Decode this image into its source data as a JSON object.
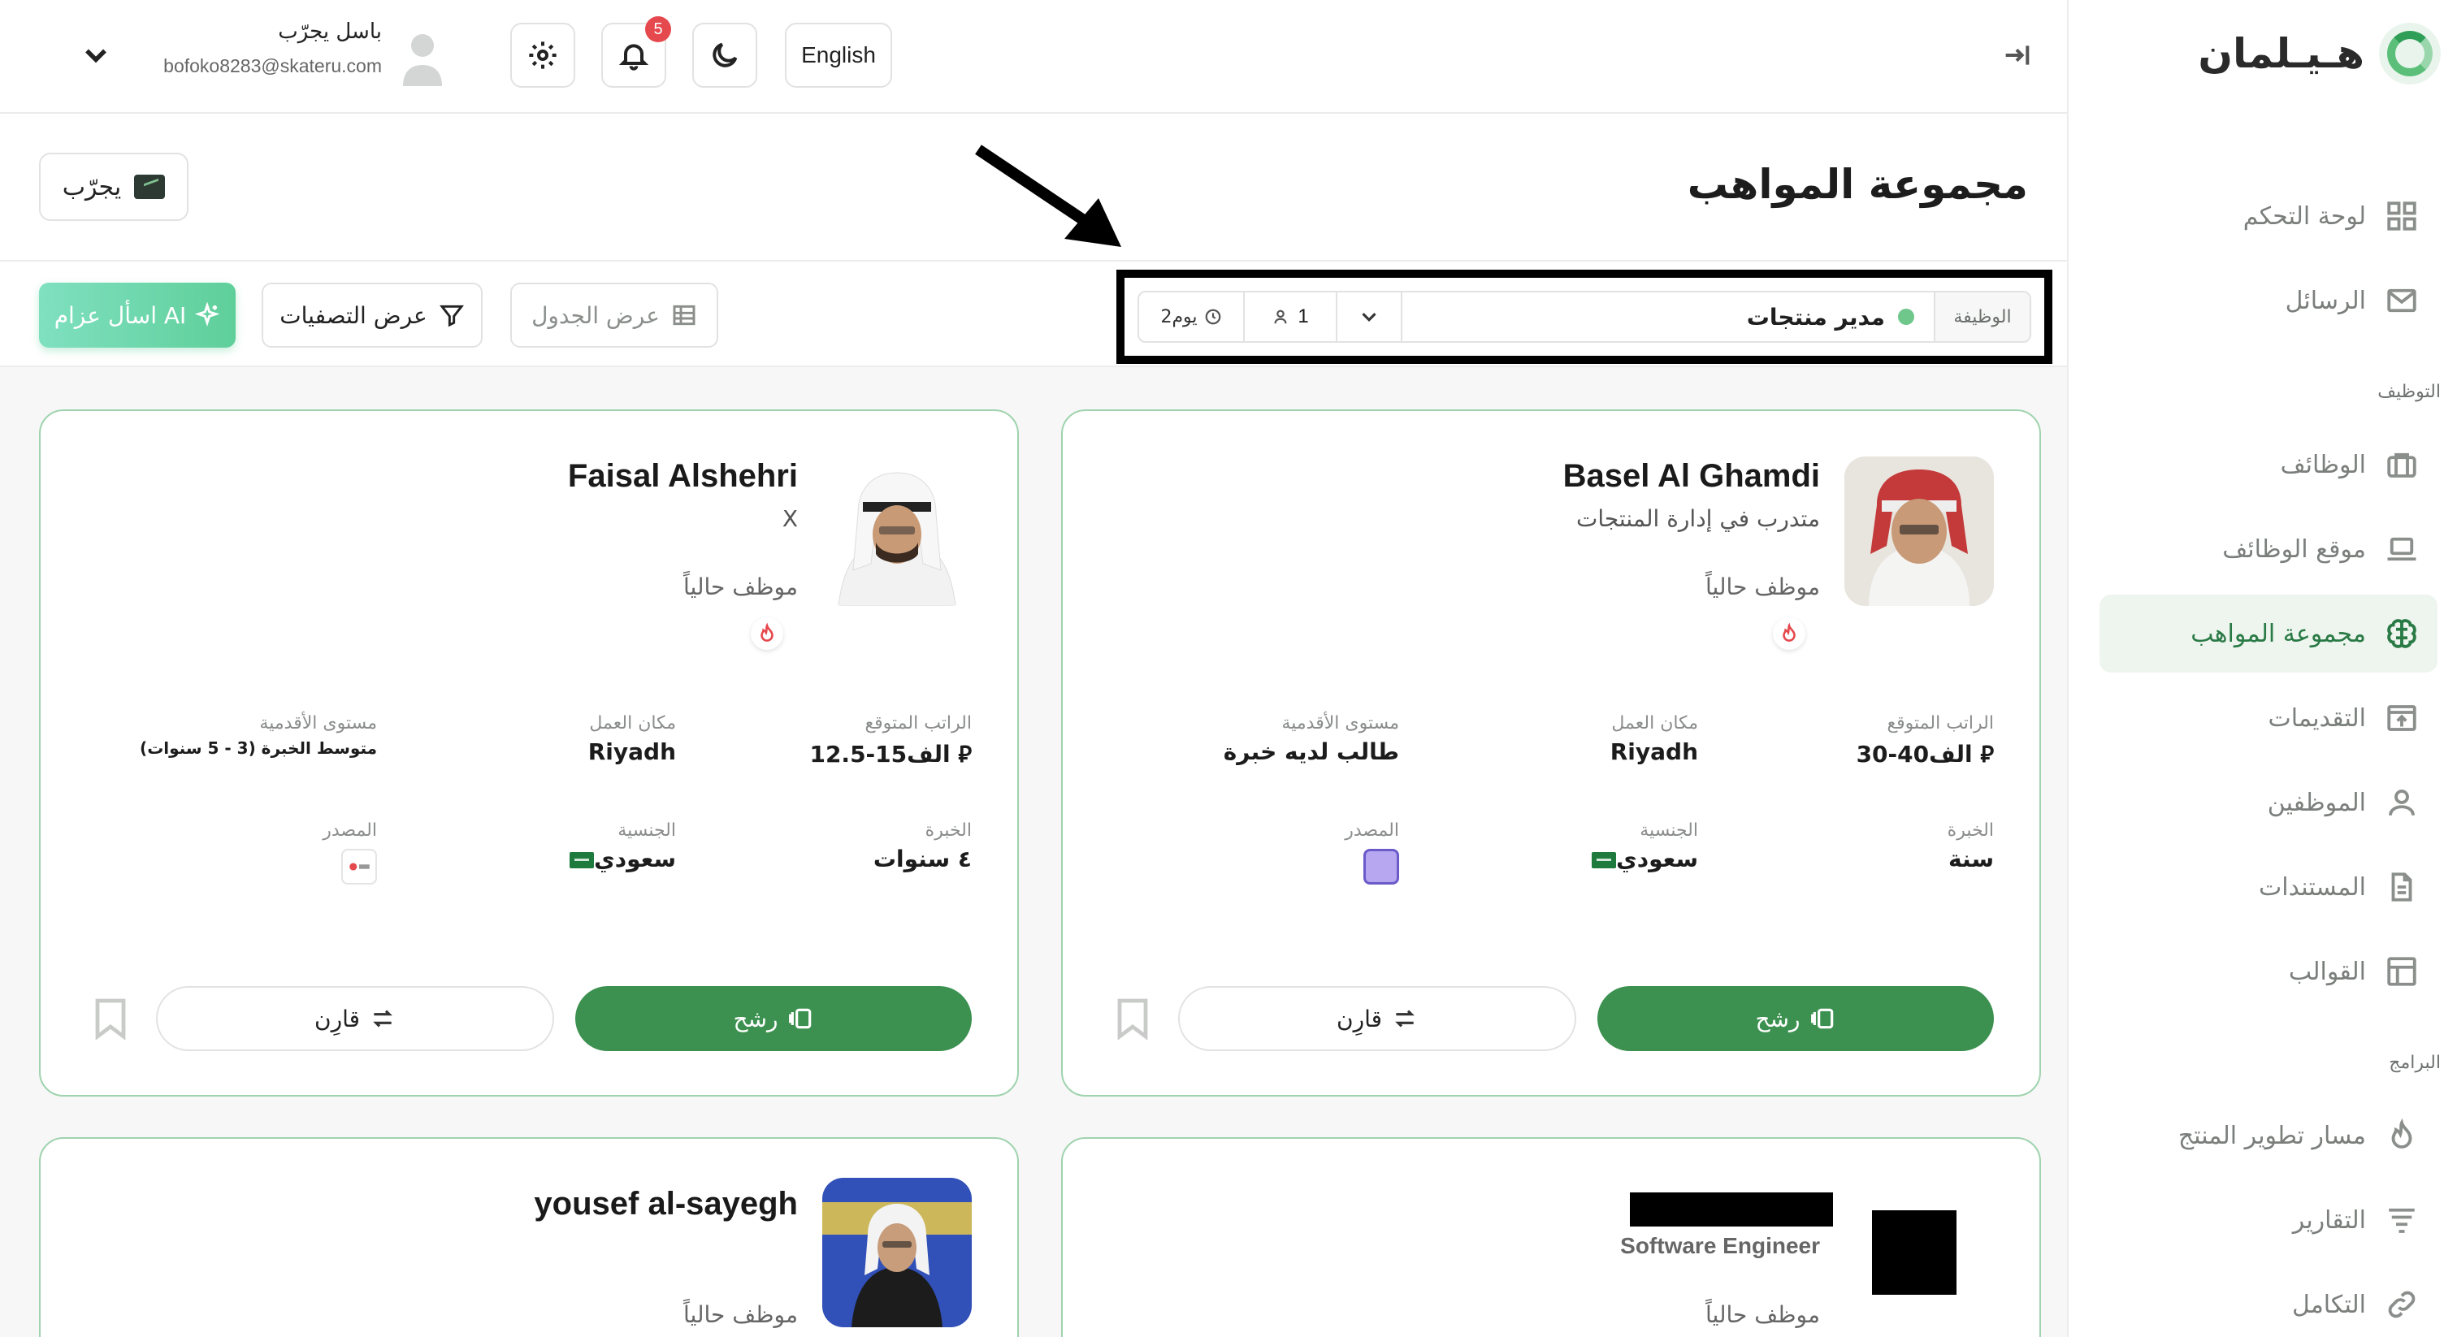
{
  "sidebar": {
    "brand": "هـيـلمان",
    "items": [
      {
        "label": "لوحة التحكم",
        "icon": "dashboard-icon"
      },
      {
        "label": "الرسائل",
        "icon": "mail-icon"
      },
      {
        "label": "الوظائف",
        "icon": "briefcase-icon"
      },
      {
        "label": "موقع الوظائف",
        "icon": "laptop-icon"
      },
      {
        "label": "مجموعة المواهب",
        "icon": "brain-icon"
      },
      {
        "label": "التقديمات",
        "icon": "upload-icon"
      },
      {
        "label": "الموظفين",
        "icon": "user-icon"
      },
      {
        "label": "المستندات",
        "icon": "document-icon"
      },
      {
        "label": "القوالب",
        "icon": "template-icon"
      },
      {
        "label": "مسار تطوير المنتج",
        "icon": "flame-icon"
      },
      {
        "label": "التقارير",
        "icon": "reports-icon"
      },
      {
        "label": "التكامل",
        "icon": "link-icon"
      }
    ],
    "sections": {
      "hiring": "التوظيف",
      "programs": "البرامج"
    },
    "active_item": "مجموعة المواهب"
  },
  "topbar": {
    "user_name": "باسل يجرّب",
    "user_email": "bofoko8283@skateru.com",
    "notifications_count": "5",
    "language_button": "English"
  },
  "header": {
    "title": "مجموعة المواهب",
    "company_button": "يجرّب"
  },
  "toolbar": {
    "job_label": "الوظيفة",
    "job_title": "مدير منتجات",
    "applicants_count": "1",
    "job_age": "2يوم",
    "table_view": "عرض الجدول",
    "filters": "عرض التصفيات",
    "ask_ai": "اسأل عزام AI"
  },
  "labels": {
    "salary": "الراتب المتوقع",
    "location": "مكان العمل",
    "seniority": "مستوى الأقدمية",
    "experience": "الخبرة",
    "nationality": "الجنسية",
    "source": "المصدر",
    "nominate": "رشح",
    "compare": "قارِن"
  },
  "candidates": [
    {
      "name": "Basel Al Ghamdi",
      "subtitle": "متدرب في إدارة المنتجات",
      "status": "موظف حالياً",
      "salary": "30-40الف",
      "location": "Riyadh",
      "seniority": "طالب لديه خبرة",
      "experience": "سنة",
      "nationality": "سعودي"
    },
    {
      "name": "Faisal Alshehri",
      "subtitle": "X",
      "status": "موظف حالياً",
      "salary": "12.5-15الف",
      "location": "Riyadh",
      "seniority": "متوسط الخبرة (3 - 5 سنوات)",
      "experience": "٤ سنوات",
      "nationality": "سعودي"
    },
    {
      "name": "",
      "subtitle": "Software Engineer",
      "status": "موظف حالياً"
    },
    {
      "name": "yousef al-sayegh",
      "subtitle": "",
      "status": "موظف حالياً"
    }
  ],
  "colors": {
    "accent": "#3c9150",
    "card_border": "#9fd3ae",
    "active_nav_bg": "#eef5ef",
    "badge": "#e5484d"
  }
}
